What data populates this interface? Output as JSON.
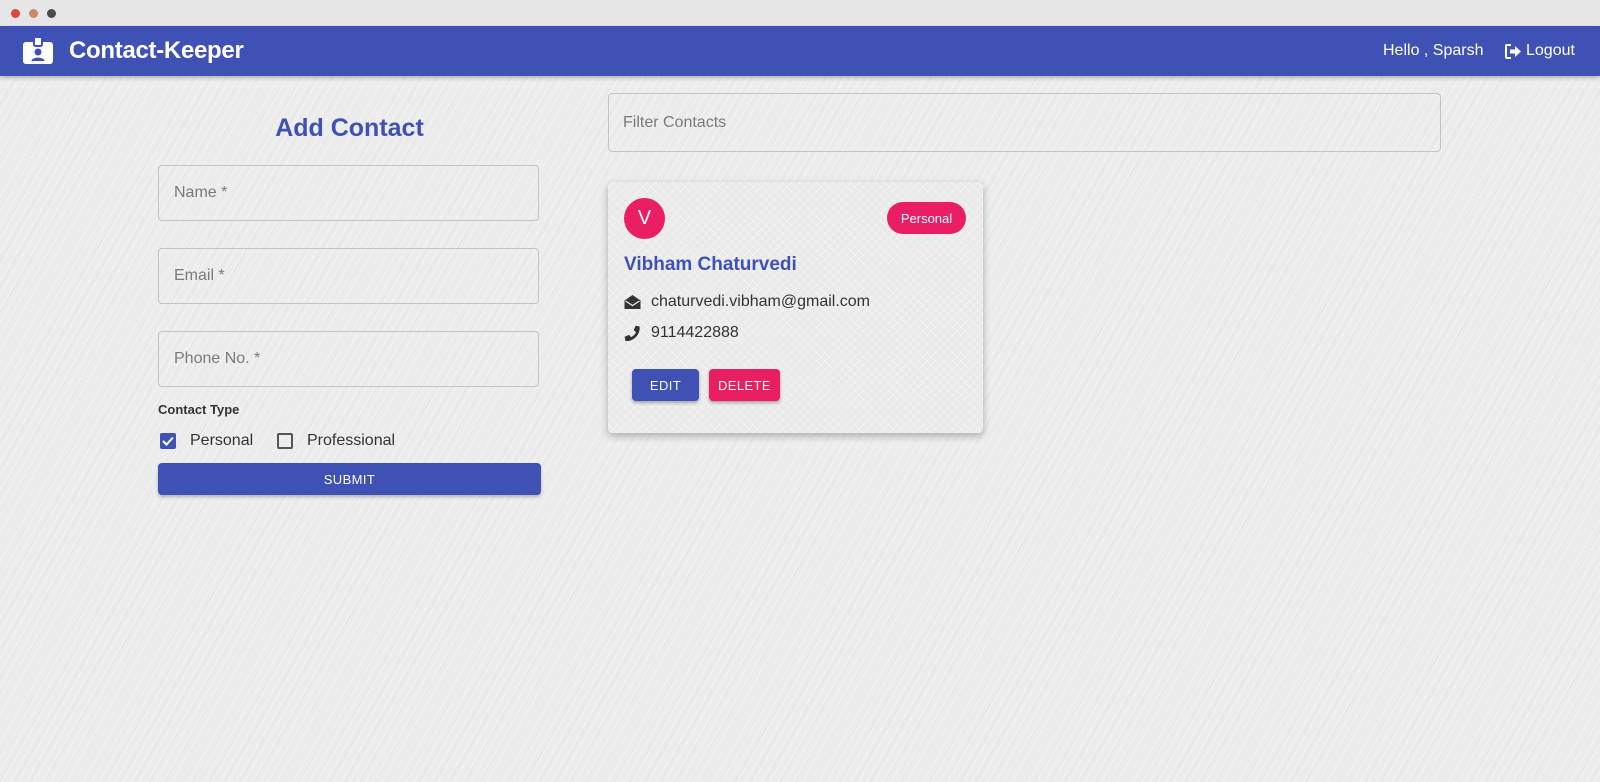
{
  "app": {
    "title": "Contact-Keeper",
    "greeting": "Hello , Sparsh",
    "logout_label": "Logout"
  },
  "colors": {
    "primary": "#3f51b5",
    "secondary": "#e91e63",
    "window_dots": [
      "#e0443e",
      "#c98a6a",
      "#4a4a4a"
    ]
  },
  "form": {
    "title": "Add Contact",
    "name_placeholder": "Name *",
    "email_placeholder": "Email *",
    "phone_placeholder": "Phone No. *",
    "contact_type_label": "Contact Type",
    "options": [
      {
        "label": "Personal",
        "checked": true
      },
      {
        "label": "Professional",
        "checked": false
      }
    ],
    "submit_label": "SUBMIT"
  },
  "filter": {
    "placeholder": "Filter Contacts"
  },
  "contacts": [
    {
      "initial": "V",
      "name": "Vibham Chaturvedi",
      "type": "Personal",
      "email": "chaturvedi.vibham@gmail.com",
      "phone": "9114422888",
      "edit_label": "EDIT",
      "delete_label": "DELETE"
    }
  ],
  "icons": {
    "brand": "contact-card-icon",
    "logout": "sign-out-icon",
    "email": "envelope-open-icon",
    "phone": "phone-icon",
    "check": "check-icon"
  }
}
